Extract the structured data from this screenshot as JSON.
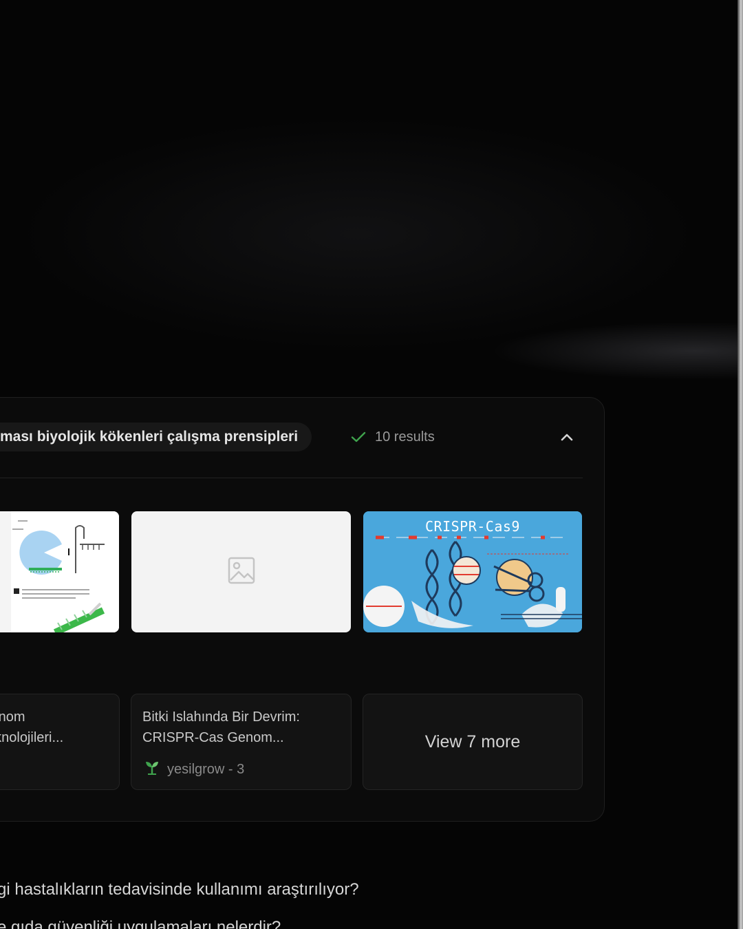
{
  "query": {
    "text": "ması biyolojik kökenleri çalışma prensipleri"
  },
  "status": {
    "icon": "check-icon",
    "label": "10 results",
    "color": "#3fa34d"
  },
  "images": [
    {
      "alt": ""
    },
    {
      "placeholder_icon": "image-placeholder-icon"
    },
    {
      "title": "CRISPR-Cas9"
    }
  ],
  "cards": [
    {
      "title": "Genom\nTeknolojileri..."
    },
    {
      "title": "Bitki Islahında Bir Devrim: CRISPR-Cas Genom...",
      "source": "yesilgrow - 3",
      "source_icon": "sprout-icon"
    },
    {
      "label": "View 7 more"
    }
  ],
  "related_questions": [
    "gi hastalıkların tedavisinde kullanımı araştırılıyor?",
    "e gıda güvenliği uygulamaları nelerdir?"
  ]
}
